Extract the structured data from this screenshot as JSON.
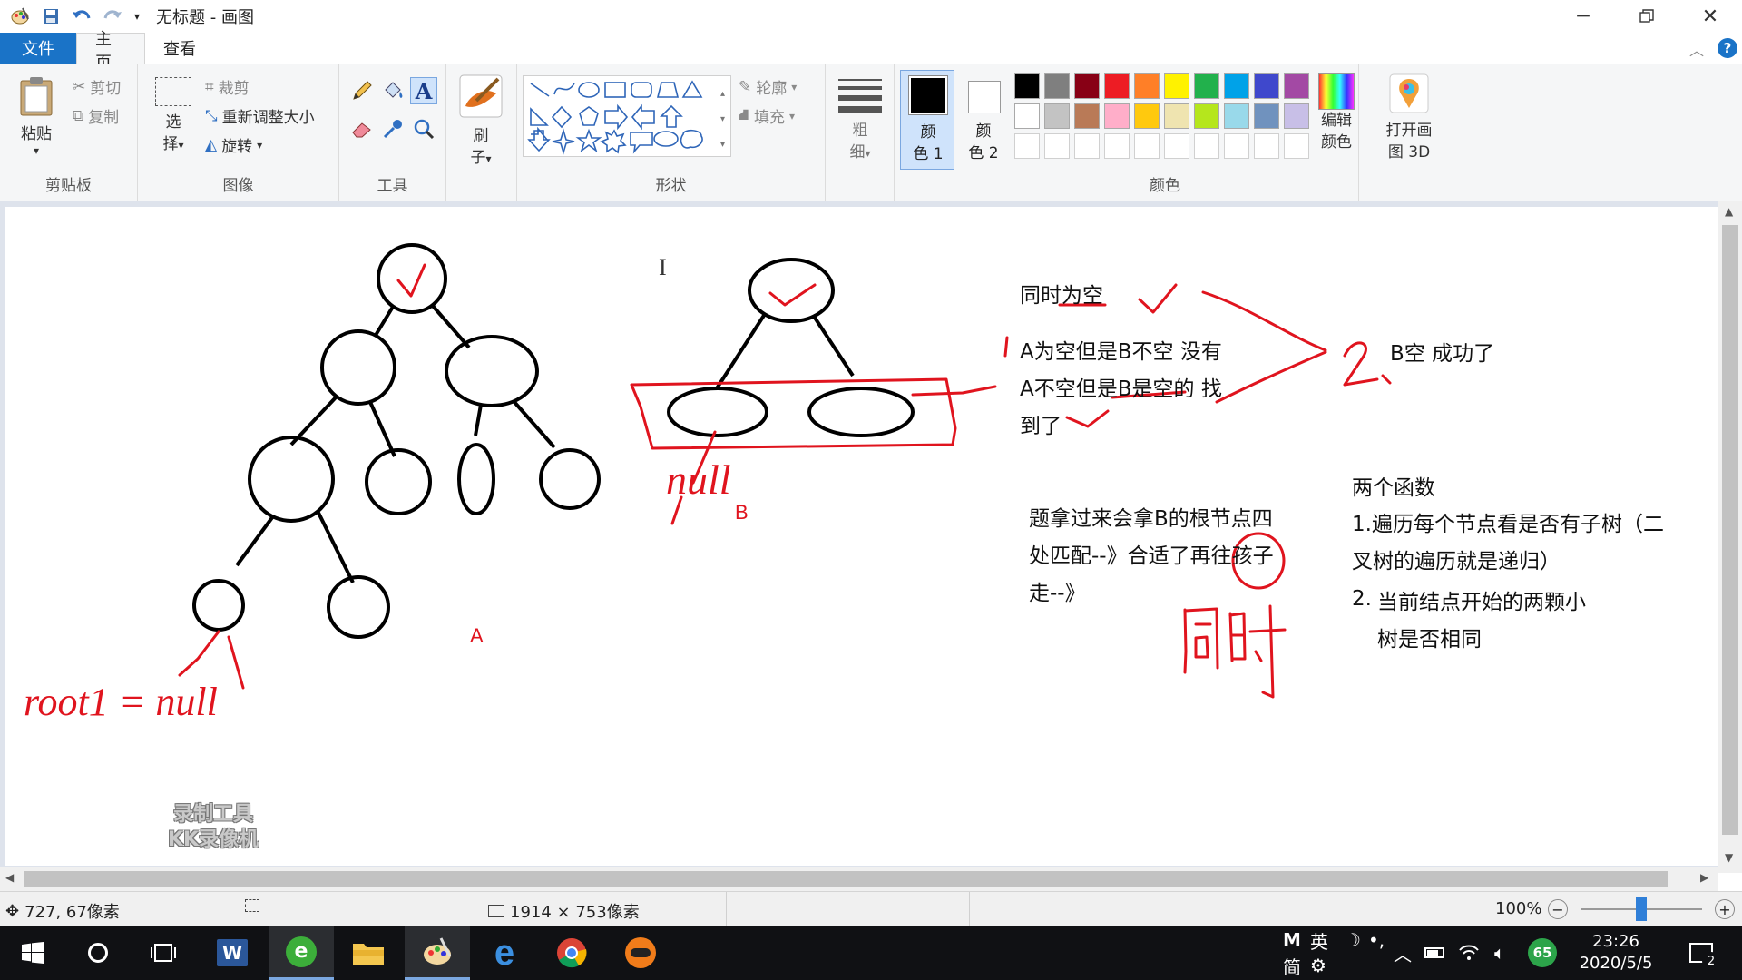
{
  "window": {
    "title": "无标题 - 画图"
  },
  "menu": {
    "file": "文件",
    "home": "主页",
    "view": "查看"
  },
  "ribbon": {
    "clipboard": {
      "label": "剪贴板",
      "paste": "粘贴",
      "cut": "剪切",
      "copy": "复制"
    },
    "image": {
      "label": "图像",
      "select": "选",
      "select2": "择",
      "crop": "裁剪",
      "resize": "重新调整大小",
      "rotate": "旋转"
    },
    "tools": {
      "label": "工具"
    },
    "brushes": {
      "label": "刷",
      "label2": "子"
    },
    "shapes": {
      "label": "形状",
      "outline": "轮廓",
      "fill": "填充"
    },
    "size": {
      "label": "粗",
      "label2": "细"
    },
    "color1": {
      "label": "颜",
      "label2": "色 1"
    },
    "color2": {
      "label": "颜",
      "label2": "色 2"
    },
    "colors": {
      "label": "颜色",
      "row1": [
        "#000000",
        "#7f7f7f",
        "#880015",
        "#ed1c24",
        "#ff7f27",
        "#fff200",
        "#22b14c",
        "#00a2e8",
        "#3f48cc",
        "#a349a4"
      ],
      "row2": [
        "#ffffff",
        "#c3c3c3",
        "#b97a57",
        "#ffaec9",
        "#ffc90e",
        "#efe4b0",
        "#b5e61d",
        "#99d9ea",
        "#7092be",
        "#c8bfe7"
      ]
    },
    "edit_colors": {
      "label": "编辑",
      "label2": "颜色"
    },
    "paint3d": {
      "label": "打开画",
      "label2": "图 3D"
    }
  },
  "canvas": {
    "tree_a_label": "A",
    "tree_b_label": "B",
    "handwriting_root": "root1 = null",
    "handwriting_null": "null",
    "handwriting_2": "2、",
    "handwriting_1": "1.",
    "handwriting_tongshi": "同时",
    "notes": {
      "n1": "同时为空",
      "n2": "A为空但是B不空 没有",
      "n3": "A不空但是B是空的 找",
      "n4": "到了",
      "n5": "B空 成功了",
      "n6": "题拿过来会拿B的根节点四",
      "n7": "处匹配--》合适了再往孩子",
      "n8": "走--》",
      "n9": "两个函数",
      "n10": "1.遍历每个节点看是否有子树（二",
      "n11": "叉树的遍历就是递归）",
      "n12": "2.",
      "n13": "当前结点开始的两颗小",
      "n14": "树是否相同"
    },
    "watermark_line1": "录制工具",
    "watermark_line2": "KK录像机"
  },
  "status": {
    "cursor_pos": "727, 67像素",
    "canvas_size": "1914 × 753像素",
    "zoom": "100%"
  },
  "taskbar": {
    "ime_mode": "M",
    "ime_lang": "英",
    "ime_simplified": "简",
    "battery_badge": "65",
    "time": "23:26",
    "date": "2020/5/5",
    "notification_count": "2"
  },
  "colors": {
    "accent": "#1a73c7",
    "ink_red": "#e0141e",
    "taskbar_bg": "#101114"
  }
}
